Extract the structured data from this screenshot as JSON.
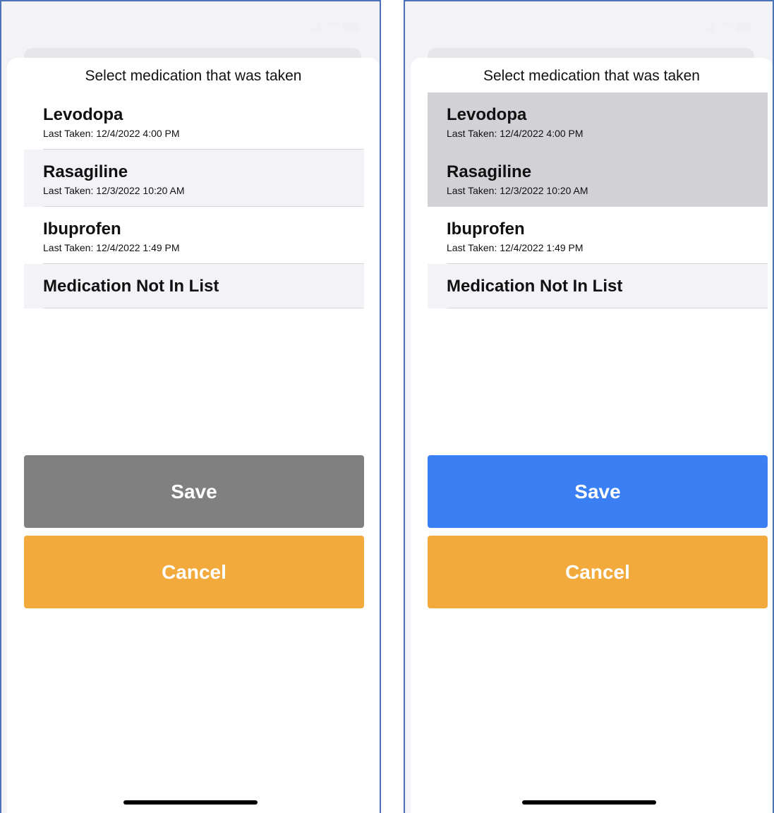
{
  "status": {
    "time": "10:05"
  },
  "screens": [
    {
      "title": "Select medication that was taken",
      "items": [
        {
          "name": "Levodopa",
          "last_taken": "Last Taken: 12/4/2022 4:00 PM",
          "state": "normal"
        },
        {
          "name": "Rasagiline",
          "last_taken": "Last Taken: 12/3/2022 10:20 AM",
          "state": "alt"
        },
        {
          "name": "Ibuprofen",
          "last_taken": "Last Taken: 12/4/2022 1:49 PM",
          "state": "normal"
        },
        {
          "name": "Medication Not In List",
          "state": "alt"
        }
      ],
      "save_label": "Save",
      "save_color": "#808080",
      "cancel_label": "Cancel",
      "cancel_color": "#f1aa3b"
    },
    {
      "title": "Select medication that was taken",
      "items": [
        {
          "name": "Levodopa",
          "last_taken": "Last Taken: 12/4/2022 4:00 PM",
          "state": "selected"
        },
        {
          "name": "Rasagiline",
          "last_taken": "Last Taken: 12/3/2022 10:20 AM",
          "state": "selected"
        },
        {
          "name": "Ibuprofen",
          "last_taken": "Last Taken: 12/4/2022 1:49 PM",
          "state": "normal"
        },
        {
          "name": "Medication Not In List",
          "state": "alt"
        }
      ],
      "save_label": "Save",
      "save_color": "#3a7ff3",
      "cancel_label": "Cancel",
      "cancel_color": "#f1aa3b"
    }
  ]
}
